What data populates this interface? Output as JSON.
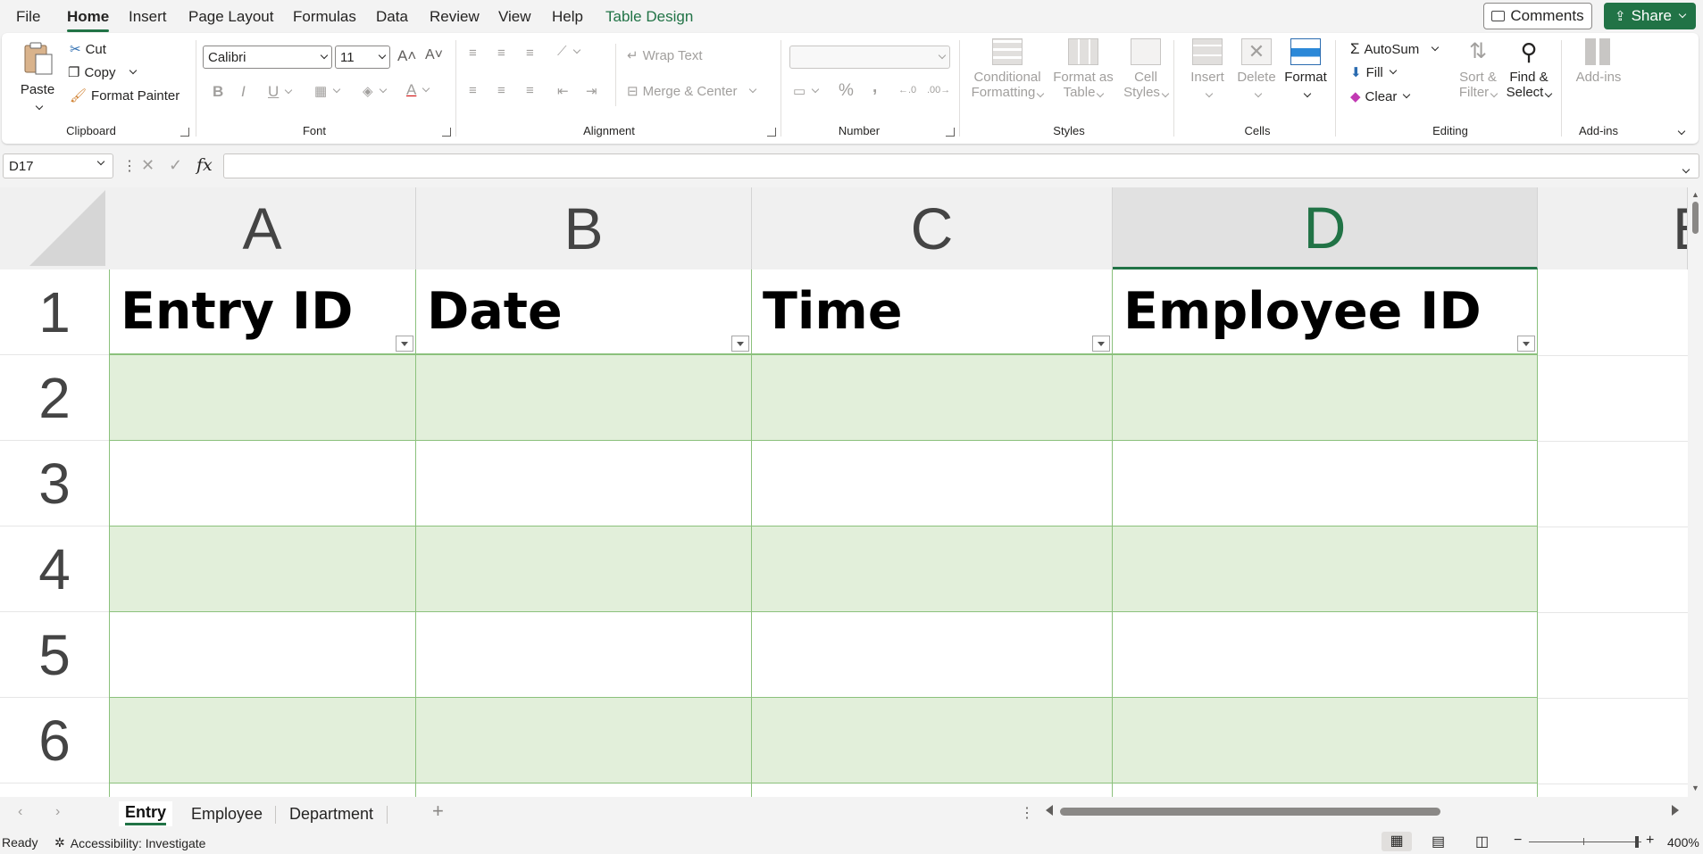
{
  "menu": {
    "tabs": [
      "File",
      "Home",
      "Insert",
      "Page Layout",
      "Formulas",
      "Data",
      "Review",
      "View",
      "Help",
      "Table Design"
    ],
    "comments": "Comments",
    "share": "Share"
  },
  "ribbon": {
    "clipboard": {
      "paste": "Paste",
      "cut": "Cut",
      "copy": "Copy",
      "format_painter": "Format Painter",
      "label": "Clipboard"
    },
    "font": {
      "name": "Calibri",
      "size": "11",
      "label": "Font",
      "bold": "B",
      "italic": "I",
      "underline": "U"
    },
    "alignment": {
      "wrap": "Wrap Text",
      "merge": "Merge & Center",
      "label": "Alignment"
    },
    "number": {
      "label": "Number",
      "percent": "%",
      "comma": ","
    },
    "styles": {
      "conditional1": "Conditional",
      "conditional2": "Formatting",
      "format_table1": "Format as",
      "format_table2": "Table",
      "cell_styles1": "Cell",
      "cell_styles2": "Styles",
      "label": "Styles"
    },
    "cells": {
      "insert": "Insert",
      "delete": "Delete",
      "format": "Format",
      "label": "Cells"
    },
    "editing": {
      "autosum": "AutoSum",
      "fill": "Fill",
      "clear": "Clear",
      "sort1": "Sort &",
      "sort2": "Filter",
      "find1": "Find &",
      "find2": "Select",
      "label": "Editing"
    },
    "addins": {
      "button": "Add-ins",
      "label": "Add-ins"
    }
  },
  "formula_bar": {
    "namebox": "D17",
    "fx": "fx",
    "value": ""
  },
  "sheet": {
    "columns": [
      "A",
      "B",
      "C",
      "D",
      "E"
    ],
    "rows": [
      "1",
      "2",
      "3",
      "4",
      "5",
      "6"
    ],
    "headers": [
      "Entry ID",
      "Date",
      "Time",
      "Employee ID"
    ],
    "band_color": "#e2efda",
    "accent": "#217346"
  },
  "tabs": {
    "items": [
      "Entry",
      "Employee",
      "Department"
    ],
    "active": "Entry"
  },
  "status": {
    "ready": "Ready",
    "accessibility": "Accessibility: Investigate",
    "zoom": "400%"
  }
}
